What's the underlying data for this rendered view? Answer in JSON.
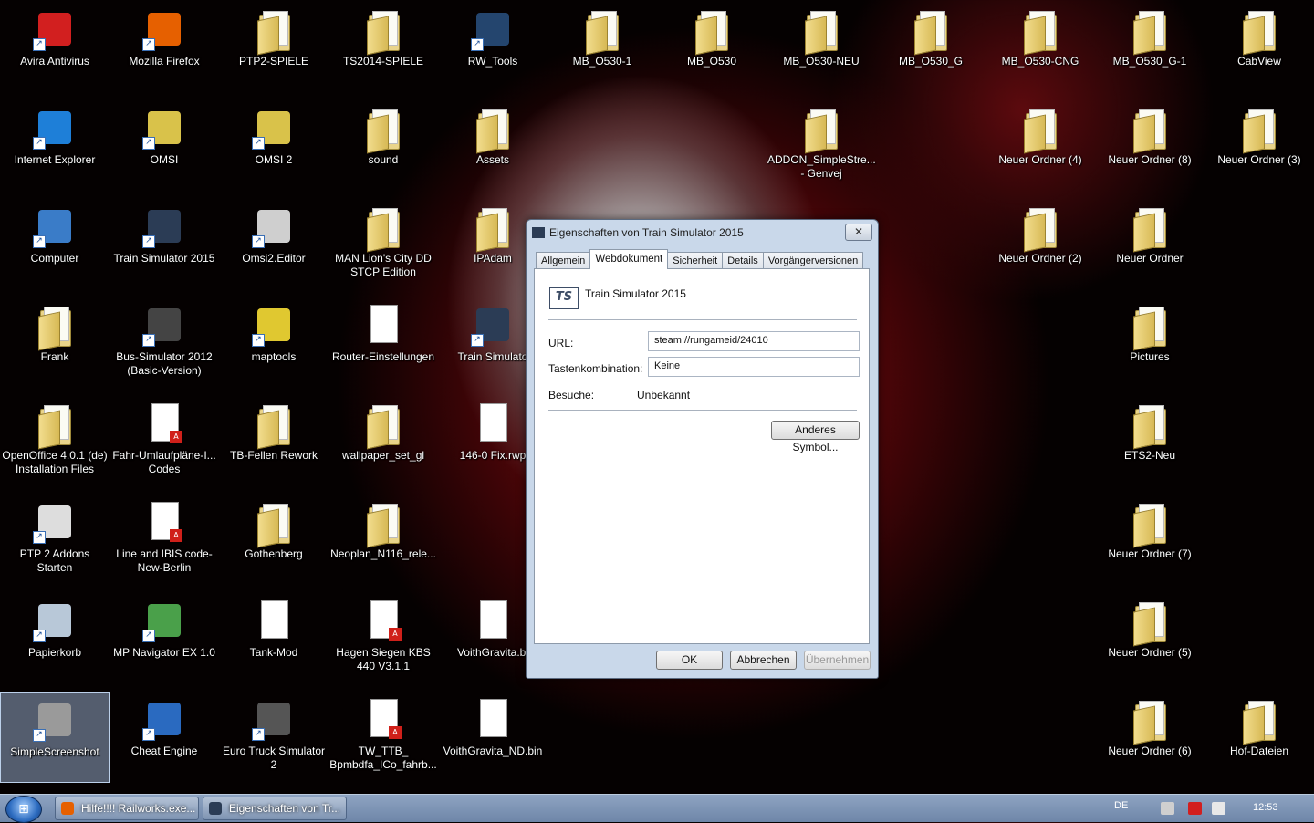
{
  "desktop": {
    "icons": [
      {
        "label": "Avira Antivirus",
        "type": "app",
        "icon": "avira-icon",
        "color": "#d21f1f"
      },
      {
        "label": "Mozilla Firefox",
        "type": "app",
        "icon": "firefox-icon",
        "color": "#e66000"
      },
      {
        "label": "PTP2-SPIELE",
        "type": "folder",
        "icon": "folder-icon"
      },
      {
        "label": "TS2014-SPIELE",
        "type": "folder",
        "icon": "folder-icon"
      },
      {
        "label": "RW_Tools",
        "type": "app",
        "icon": "train-icon",
        "color": "#24456e"
      },
      {
        "label": "MB_O530-1",
        "type": "folder",
        "icon": "folder-icon"
      },
      {
        "label": "MB_O530",
        "type": "folder",
        "icon": "folder-icon"
      },
      {
        "label": "MB_O530-NEU",
        "type": "folder",
        "icon": "folder-icon"
      },
      {
        "label": "MB_O530_G",
        "type": "folder",
        "icon": "folder-icon"
      },
      {
        "label": "MB_O530-CNG",
        "type": "folder",
        "icon": "folder-icon"
      },
      {
        "label": "MB_O530_G-1",
        "type": "folder",
        "icon": "folder-icon"
      },
      {
        "label": "CabView",
        "type": "folder",
        "icon": "folder-icon"
      },
      {
        "label": "Internet Explorer",
        "type": "app",
        "icon": "internet-explorer-icon",
        "color": "#1e7fd8"
      },
      {
        "label": "OMSI",
        "type": "app",
        "icon": "bus-icon",
        "color": "#d9c24a"
      },
      {
        "label": "OMSI 2",
        "type": "app",
        "icon": "bus-icon",
        "color": "#d9c24a"
      },
      {
        "label": "sound",
        "type": "folder",
        "icon": "folder-icon"
      },
      {
        "label": "Assets",
        "type": "folder",
        "icon": "folder-icon"
      },
      {
        "label": "ADDON_SimpleStre... - Genvej",
        "type": "folder",
        "icon": "folder-icon"
      },
      {
        "label": "Neuer Ordner (4)",
        "type": "folder",
        "icon": "folder-icon"
      },
      {
        "label": "Neuer Ordner (8)",
        "type": "folder",
        "icon": "folder-icon"
      },
      {
        "label": "Neuer Ordner (3)",
        "type": "folder",
        "icon": "folder-icon"
      },
      {
        "label": "Computer",
        "type": "app",
        "icon": "computer-icon",
        "color": "#3a7cc8"
      },
      {
        "label": "Train Simulator 2015",
        "type": "app",
        "icon": "ts-icon",
        "color": "#2b3c55"
      },
      {
        "label": "Omsi2.Editor",
        "type": "app",
        "icon": "bus-icon",
        "color": "#cfcfcf"
      },
      {
        "label": "MAN Lion's City DD STCP Edition",
        "type": "folder",
        "icon": "folder-icon"
      },
      {
        "label": "IPAdam",
        "type": "folder",
        "icon": "folder-icon"
      },
      {
        "label": "Neuer Ordner (2)",
        "type": "folder",
        "icon": "folder-icon"
      },
      {
        "label": "Neuer Ordner",
        "type": "folder",
        "icon": "folder-icon"
      },
      {
        "label": "Frank",
        "type": "folder",
        "icon": "folder-icon"
      },
      {
        "label": "Bus-Simulator 2012 (Basic-Version)",
        "type": "app",
        "icon": "wheel-icon",
        "color": "#444444"
      },
      {
        "label": "maptools",
        "type": "app",
        "icon": "bus-icon",
        "color": "#e0c830"
      },
      {
        "label": "Router-Einstellungen",
        "type": "doc",
        "icon": "document-icon"
      },
      {
        "label": "Train Simulato",
        "type": "app",
        "icon": "ts-icon",
        "color": "#2b3c55"
      },
      {
        "label": "Pictures",
        "type": "folder",
        "icon": "folder-icon"
      },
      {
        "label": "OpenOffice 4.0.1 (de) Installation Files",
        "type": "folder",
        "icon": "folder-icon"
      },
      {
        "label": "Fahr-Umlaufpläne-I... Codes",
        "type": "pdf",
        "icon": "pdf-icon"
      },
      {
        "label": "TB-Fellen Rework",
        "type": "folder",
        "icon": "folder-icon"
      },
      {
        "label": "wallpaper_set_gl",
        "type": "folder",
        "icon": "folder-icon"
      },
      {
        "label": "146-0 Fix.rwp",
        "type": "doc",
        "icon": "document-icon"
      },
      {
        "label": "ETS2-Neu",
        "type": "folder",
        "icon": "folder-icon"
      },
      {
        "label": "PTP 2 Addons Starten",
        "type": "app",
        "icon": "train-icon",
        "color": "#dddddd"
      },
      {
        "label": "Line and IBIS code-New-Berlin",
        "type": "pdf",
        "icon": "pdf-icon"
      },
      {
        "label": "Gothenberg",
        "type": "folder",
        "icon": "folder-icon"
      },
      {
        "label": "Neoplan_N116_rele...",
        "type": "folder",
        "icon": "folder-icon"
      },
      {
        "label": "Neuer Ordner (7)",
        "type": "folder",
        "icon": "folder-icon"
      },
      {
        "label": "Papierkorb",
        "type": "app",
        "icon": "recycle-bin-icon",
        "color": "#b8c8d8"
      },
      {
        "label": "MP Navigator EX 1.0",
        "type": "app",
        "icon": "scanner-icon",
        "color": "#4aa04a"
      },
      {
        "label": "Tank-Mod",
        "type": "doc",
        "icon": "document-icon"
      },
      {
        "label": "Hagen Siegen KBS 440 V3.1.1",
        "type": "pdf",
        "icon": "pdf-icon"
      },
      {
        "label": "VoithGravita.bi",
        "type": "doc",
        "icon": "document-icon"
      },
      {
        "label": "Neuer Ordner (5)",
        "type": "folder",
        "icon": "folder-icon"
      },
      {
        "label": "SimpleScreenshot",
        "type": "app",
        "icon": "camera-icon",
        "color": "#9a9a9a",
        "selected": true
      },
      {
        "label": "Cheat Engine",
        "type": "app",
        "icon": "cheat-engine-icon",
        "color": "#2a6ac0"
      },
      {
        "label": "Euro Truck Simulator 2",
        "type": "app",
        "icon": "truck-icon",
        "color": "#555555"
      },
      {
        "label": "TW_TTB_ Bpmbdfa_ICo_fahrb...",
        "type": "pdf",
        "icon": "pdf-icon"
      },
      {
        "label": "VoithGravita_ND.bin",
        "type": "doc",
        "icon": "document-icon"
      },
      {
        "label": "Neuer Ordner (6)",
        "type": "folder",
        "icon": "folder-icon"
      },
      {
        "label": "Hof-Dateien",
        "type": "folder",
        "icon": "folder-icon"
      }
    ]
  },
  "dialog": {
    "title": "Eigenschaften von Train Simulator 2015",
    "close": "✕",
    "tabs": [
      "Allgemein",
      "Webdokument",
      "Sicherheit",
      "Details",
      "Vorgängerversionen"
    ],
    "active_tab": "Webdokument",
    "program_icon_text": "TS",
    "program_name": "Train Simulator 2015",
    "url_label": "URL:",
    "url_value": "steam://rungameid/24010",
    "hotkey_label": "Tastenkombination:",
    "hotkey_value": "Keine",
    "visits_label": "Besuche:",
    "visits_value": "Unbekannt",
    "change_icon_button": "Anderes Symbol...",
    "ok_button": "OK",
    "cancel_button": "Abbrechen",
    "apply_button": "Übernehmen"
  },
  "taskbar": {
    "start_glyph": "⊞",
    "tasks": [
      {
        "label": "Hilfe!!!! Railworks.exe...",
        "icon": "firefox-icon",
        "color": "#e66000"
      },
      {
        "label": "Eigenschaften von Tr...",
        "icon": "properties-icon",
        "color": "#2b3c55"
      }
    ],
    "language": "DE",
    "tray": [
      {
        "icon": "camera-tray-icon",
        "color": "#cfcfcf"
      },
      {
        "icon": "avira-tray-icon",
        "color": "#d21f1f"
      },
      {
        "icon": "volume-icon",
        "color": "#e8e8e8"
      }
    ],
    "clock": "12:53"
  }
}
